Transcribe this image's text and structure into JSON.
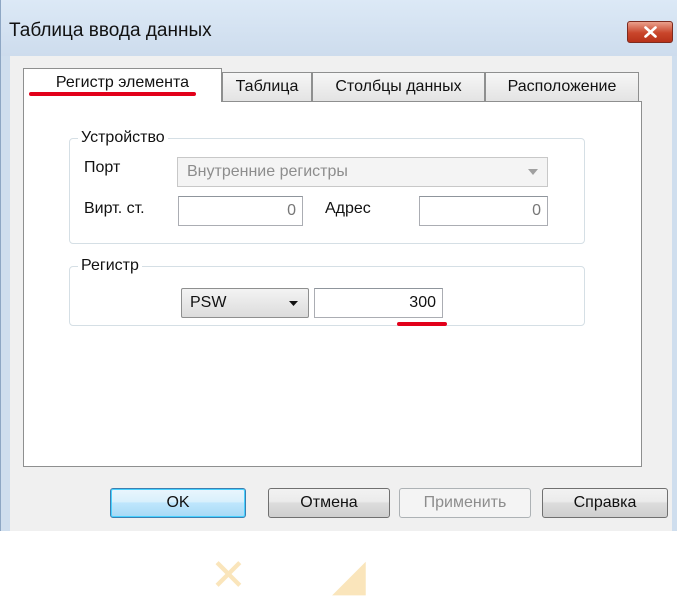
{
  "window": {
    "title": "Таблица ввода данных"
  },
  "tabs": [
    {
      "label": "Регистр элемента",
      "active": true
    },
    {
      "label": "Таблица",
      "active": false
    },
    {
      "label": "Столбцы данных",
      "active": false
    },
    {
      "label": "Расположение",
      "active": false
    }
  ],
  "device_group": {
    "title": "Устройство",
    "port_label": "Порт",
    "port_value": "Внутренние регистры",
    "station_label": "Вирт. ст.",
    "station_value": "0",
    "address_label": "Адрес",
    "address_value": "0"
  },
  "register_group": {
    "title": "Регистр",
    "type_value": "PSW",
    "number_value": "300"
  },
  "buttons": {
    "ok": "OK",
    "cancel": "Отмена",
    "apply": "Применить",
    "help": "Справка"
  },
  "colors": {
    "highlight": "#e2001a",
    "title_bar": "#cfdeee"
  },
  "icons": [
    "close-icon",
    "dropdown-arrow-icon"
  ]
}
